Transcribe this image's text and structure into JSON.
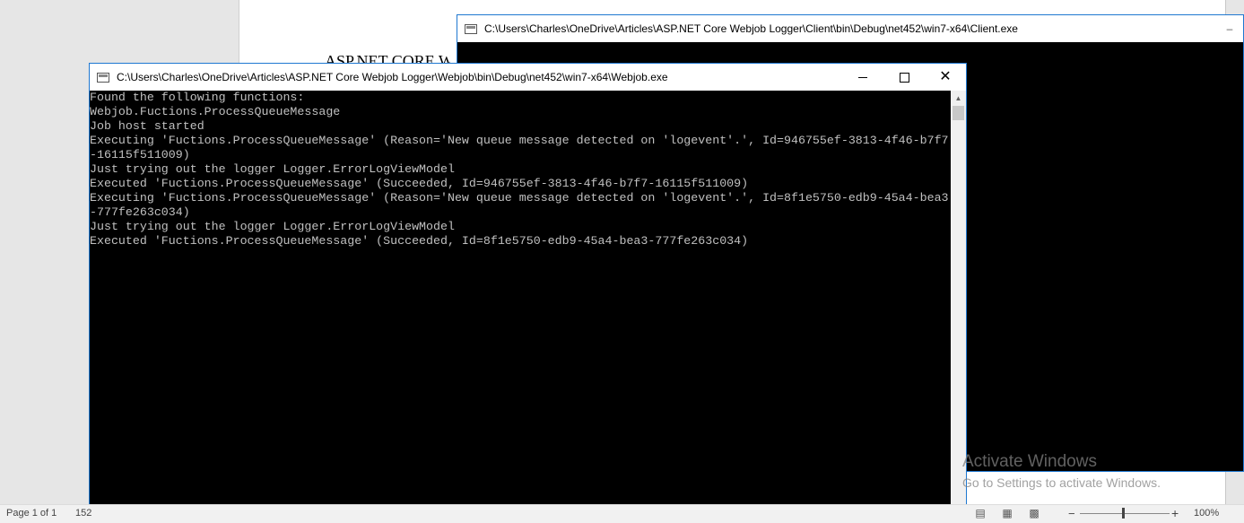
{
  "word": {
    "doc_heading": "ASP.NET CORE Webjob",
    "status": {
      "page": "Page 1 of 1",
      "words": "152",
      "zoom_minus": "−",
      "zoom_plus": "+",
      "zoom_percent": "100%",
      "zoom_level": 1.0
    },
    "view_icons": [
      "read-mode-icon",
      "print-layout-icon",
      "web-layout-icon"
    ]
  },
  "client_window": {
    "title": "C:\\Users\\Charles\\OneDrive\\Articles\\ASP.NET Core Webjob Logger\\Client\\bin\\Debug\\net452\\win7-x64\\Client.exe",
    "minimize": "–"
  },
  "webjob_window": {
    "title": "C:\\Users\\Charles\\OneDrive\\Articles\\ASP.NET Core Webjob Logger\\Webjob\\bin\\Debug\\net452\\win7-x64\\Webjob.exe",
    "close_glyph": "✕",
    "scroll_up": "▲",
    "scroll_down": "▼",
    "output": "Found the following functions:\nWebjob.Fuctions.ProcessQueueMessage\nJob host started\nExecuting 'Fuctions.ProcessQueueMessage' (Reason='New queue message detected on 'logevent'.', Id=946755ef-3813-4f46-b7f7\n-16115f511009)\nJust trying out the logger Logger.ErrorLogViewModel\nExecuted 'Fuctions.ProcessQueueMessage' (Succeeded, Id=946755ef-3813-4f46-b7f7-16115f511009)\nExecuting 'Fuctions.ProcessQueueMessage' (Reason='New queue message detected on 'logevent'.', Id=8f1e5750-edb9-45a4-bea3\n-777fe263c034)\nJust trying out the logger Logger.ErrorLogViewModel\nExecuted 'Fuctions.ProcessQueueMessage' (Succeeded, Id=8f1e5750-edb9-45a4-bea3-777fe263c034)"
  },
  "watermark": {
    "line1": "Activate Windows",
    "line2": "Go to Settings to activate Windows."
  },
  "colors": {
    "console_bg": "#000000",
    "console_text": "#c0c0c0",
    "window_border": "#1f78d1"
  }
}
